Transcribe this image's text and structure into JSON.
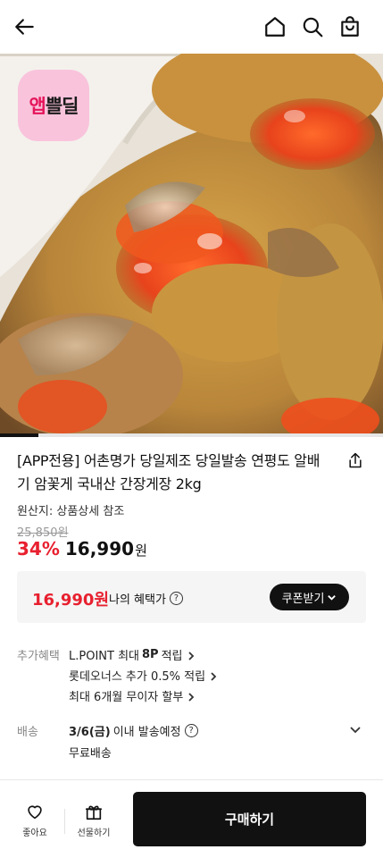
{
  "header": {
    "back_icon": "arrow-left-icon",
    "home_icon": "home-icon",
    "search_icon": "search-icon",
    "cart_icon": "shopping-bag-icon"
  },
  "hero": {
    "badge_part1": "앱",
    "badge_part2": "쁠딜",
    "badge_color": "#f9c3dc",
    "badge_accent": "#e5155a",
    "image_progress": 0.1
  },
  "product": {
    "title": "[APP전용] 어촌명가 당일제조 당일발송 연평도 알배기 암꽃게 국내산 간장게장 2kg",
    "origin": "원산지: 상품상세 참조",
    "original_price": "25,850원",
    "discount": "34%",
    "price": "16,990",
    "currency": "원"
  },
  "benefit": {
    "price": "16,990원",
    "label": "나의 혜택가",
    "help": "?",
    "coupon_button": "쿠폰받기"
  },
  "extra": {
    "label": "추가혜택",
    "lines": [
      {
        "before": "L.POINT 최대",
        "bold": "8P",
        "after": "적립"
      },
      {
        "before": "롯데오너스 추가 0.5% 적립",
        "bold": "",
        "after": ""
      },
      {
        "before": "최대 6개월 무이자 할부",
        "bold": "",
        "after": ""
      }
    ]
  },
  "shipping": {
    "label": "배송",
    "date": "3/6(금)",
    "date_suffix": "이내 발송예정",
    "help": "?",
    "fee": "무료배송"
  },
  "bottom": {
    "like_label": "좋아요",
    "gift_label": "선물하기",
    "buy_label": "구매하기"
  },
  "colors": {
    "accent_red": "#e8202f",
    "dark": "#111111"
  }
}
